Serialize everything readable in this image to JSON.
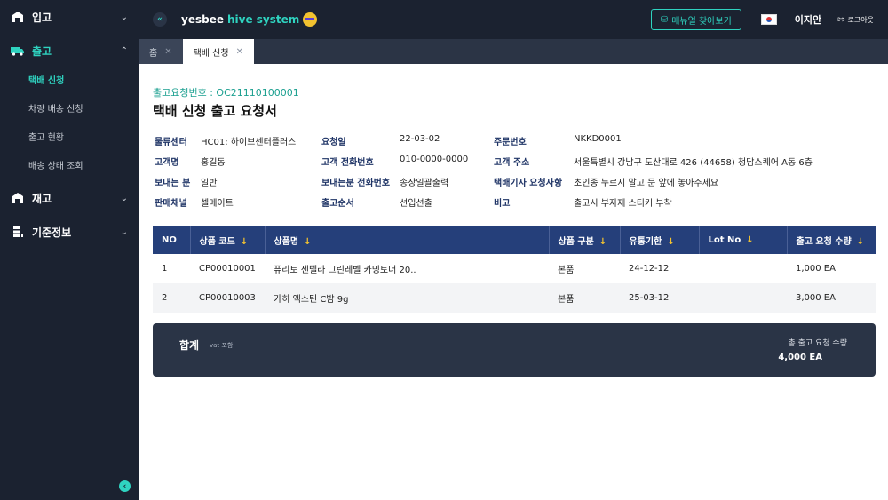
{
  "sidebar": {
    "groups": [
      {
        "label": "입고",
        "icon": "warehouse-icon"
      },
      {
        "label": "출고",
        "icon": "truck-icon"
      },
      {
        "label": "재고",
        "icon": "warehouse-icon"
      },
      {
        "label": "기준정보",
        "icon": "database-icon"
      }
    ],
    "outbound_items": [
      "택배 신청",
      "차량 배송 신청",
      "출고 현황",
      "배송 상태 조회"
    ]
  },
  "header": {
    "brand": "yesbee",
    "system": "hive system",
    "manual_label": "매뉴얼 찾아보기",
    "user_name": "이지안",
    "logout_label": "로그아웃"
  },
  "tabs": [
    {
      "label": "홈"
    },
    {
      "label": "택배 신청"
    }
  ],
  "page": {
    "request_no": "출고요청번호 : OC21110100001",
    "title": "택배 신청 출고 요청서"
  },
  "info": {
    "center_k": "물류센터",
    "center_v": "HC01: 하이브센터플러스",
    "req_date_k": "요청일",
    "req_date_v": "22-03-02",
    "order_no_k": "주문번호",
    "order_no_v": "NKKD0001",
    "customer_k": "고객명",
    "customer_v": "홍길동",
    "phone_k": "고객 전화번호",
    "phone_v": "010-0000-0000",
    "address_k": "고객 주소",
    "address_v": "서울특별시 강남구 도산대로 426 (44658) 청담스퀘어 A동 6층",
    "sender_k": "보내는 분",
    "sender_v": "일반",
    "sender_phone_k": "보내는분 전화번호",
    "sender_phone_v": "송장일괄출력",
    "courier_note_k": "택배기사 요청사항",
    "courier_note_v": "초인종 누르지 말고 문 앞에 놓아주세요",
    "channel_k": "판매채널",
    "channel_v": "셀메이트",
    "order_k": "출고순서",
    "order_v": "선입선출",
    "memo_k": "비고",
    "memo_v": "출고시 부자재 스티커 부착"
  },
  "table": {
    "headers": [
      "NO",
      "상품 코드",
      "상품명",
      "상품 구분",
      "유통기한",
      "Lot No",
      "출고 요청 수량"
    ],
    "rows": [
      {
        "no": "1",
        "code": "CP00010001",
        "name": "퓨리토 센텔라 그린레벨 카밍토너 20..",
        "kind": "본품",
        "expiry": "24-12-12",
        "lot": "",
        "qty": "1,000 EA"
      },
      {
        "no": "2",
        "code": "CP00010003",
        "name": "가히 엑스틴 C밤 9g",
        "kind": "본품",
        "expiry": "25-03-12",
        "lot": "",
        "qty": "3,000 EA"
      }
    ]
  },
  "summary": {
    "label": "합계",
    "vat": "vat 포함",
    "total_label": "총 출고 요청 수량",
    "total_value": "4,000 EA"
  },
  "colors": {
    "accent": "#2fd3c0",
    "sidebar_bg": "#1b2230",
    "table_header": "#253f7a"
  }
}
